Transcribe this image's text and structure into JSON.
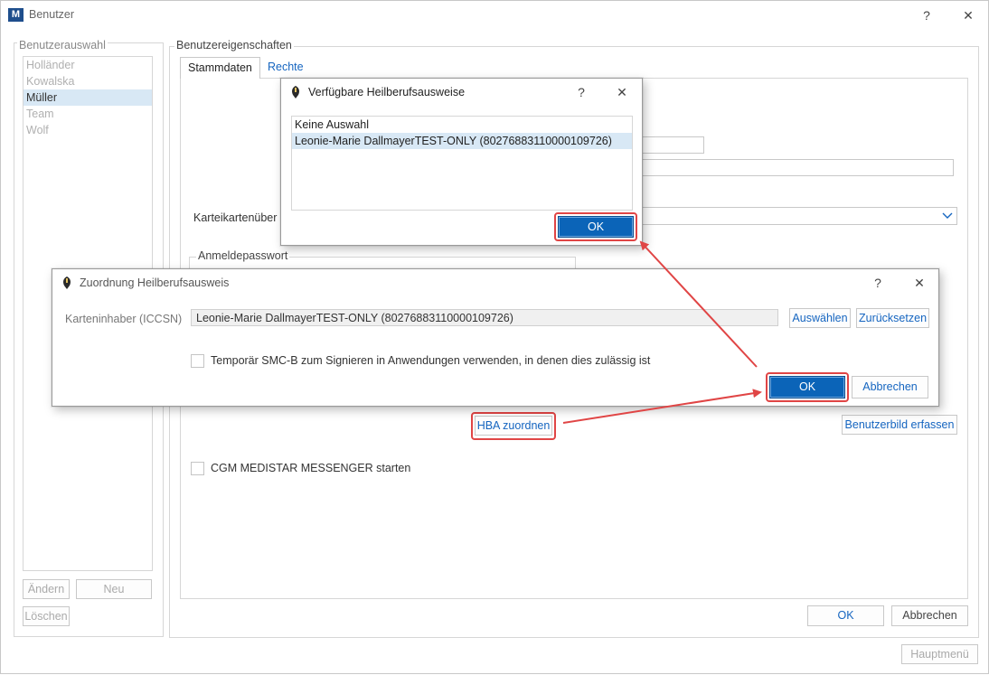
{
  "window": {
    "title": "Benutzer",
    "logo_text": "M",
    "help_glyph": "?",
    "close_glyph": "✕"
  },
  "user_select": {
    "group_title": "Benutzerauswahl",
    "users": [
      "Holländer",
      "Kowalska",
      "Müller",
      "Team",
      "Wolf"
    ],
    "selected_index": 2,
    "change_label": "Ändern",
    "new_label": "Neu",
    "delete_label": "Löschen"
  },
  "properties": {
    "group_title": "Benutzereigenschaften",
    "tabs": [
      "Stammdaten",
      "Rechte"
    ],
    "karteikarten_label": "Karteikartenüber",
    "password_group": "Anmeldepasswort",
    "hba_assign_label": "HBA zuordnen",
    "user_image_label": "Benutzerbild erfassen",
    "messenger_label": "CGM MEDISTAR MESSENGER starten",
    "ok_label": "OK",
    "cancel_label": "Abbrechen"
  },
  "main_menu_label": "Hauptmenü",
  "dialog_hba_list": {
    "title": "Verfügbare Heilberufsausweise",
    "help_glyph": "?",
    "close_glyph": "✕",
    "items": [
      "Keine Auswahl",
      "Leonie-Marie DallmayerTEST-ONLY (80276883110000109726)"
    ],
    "selected_index": 1,
    "ok_label": "OK"
  },
  "dialog_assign": {
    "title": "Zuordnung Heilberufsausweis",
    "help_glyph": "?",
    "close_glyph": "✕",
    "holder_label": "Karteninhaber (ICCSN)",
    "holder_value": "Leonie-Marie DallmayerTEST-ONLY (80276883110000109726)",
    "select_label": "Auswählen",
    "reset_label": "Zurücksetzen",
    "smcb_label": "Temporär SMC-B zum Signieren in Anwendungen verwenden, in denen dies zulässig ist",
    "ok_label": "OK",
    "cancel_label": "Abbrechen"
  },
  "colors": {
    "primary": "#0b64b8",
    "link": "#1565c0",
    "highlight": "#e04545",
    "selection": "#d8e8f5"
  }
}
